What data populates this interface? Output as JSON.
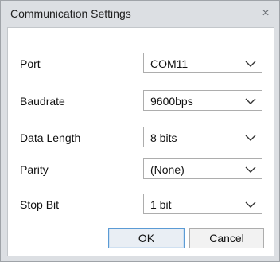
{
  "window": {
    "title": "Communication Settings",
    "close_glyph": "×"
  },
  "fields": [
    {
      "label": "Port",
      "value": "COM11"
    },
    {
      "label": "Baudrate",
      "value": "9600bps"
    },
    {
      "label": "Data Length",
      "value": "8 bits"
    },
    {
      "label": "Parity",
      "value": "(None)"
    },
    {
      "label": "Stop Bit",
      "value": "1 bit"
    }
  ],
  "buttons": {
    "ok": "OK",
    "cancel": "Cancel"
  },
  "icons": {
    "close": "close-icon",
    "dropdown": "chevron-down-icon"
  },
  "colors": {
    "titlebar": "#dcdfe3",
    "content_bg": "#ffffff",
    "focus_border": "#5b9bd5"
  }
}
